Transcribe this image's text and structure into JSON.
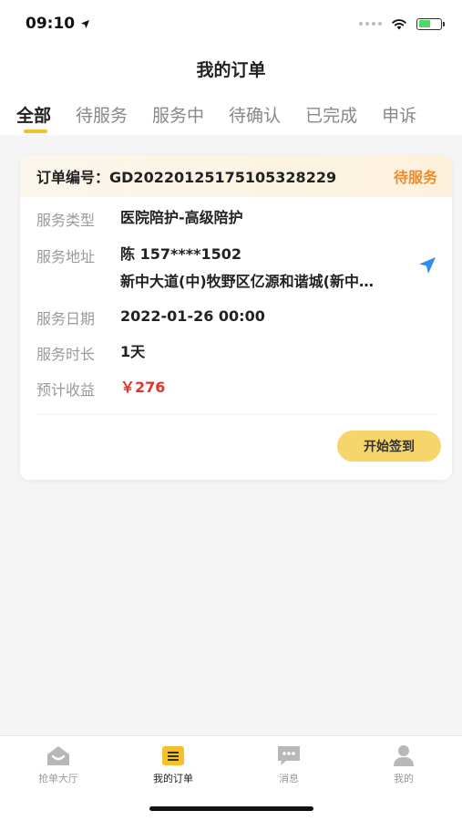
{
  "status_bar": {
    "time": "09:10"
  },
  "nav": {
    "title": "我的订单"
  },
  "tabs": [
    {
      "label": "全部"
    },
    {
      "label": "待服务"
    },
    {
      "label": "服务中"
    },
    {
      "label": "待确认"
    },
    {
      "label": "已完成"
    },
    {
      "label": "申诉"
    }
  ],
  "order": {
    "no_label": "订单编号：",
    "no_value": "GD20220125175105328229",
    "status": "待服务",
    "rows": {
      "type": {
        "label": "服务类型",
        "value": "医院陪护-高级陪护"
      },
      "address": {
        "label": "服务地址",
        "line1": "陈 157****1502",
        "line2": "新中大道(中)牧野区亿源和谐城(新中…"
      },
      "date": {
        "label": "服务日期",
        "value": "2022-01-26 00:00"
      },
      "duration": {
        "label": "服务时长",
        "value": "1天"
      },
      "income": {
        "label": "预计收益",
        "value": "￥276"
      }
    },
    "action_button": "开始签到"
  },
  "tabbar": [
    {
      "label": "抢单大厅",
      "icon": "hall-icon"
    },
    {
      "label": "我的订单",
      "icon": "orders-icon"
    },
    {
      "label": "消息",
      "icon": "message-icon"
    },
    {
      "label": "我的",
      "icon": "profile-icon"
    }
  ],
  "colors": {
    "accent": "#f6c02a",
    "status_orange": "#ef8b2c",
    "price_red": "#e2332c",
    "button_yellow": "#f6d56b",
    "locate_blue": "#2f8cf0"
  }
}
